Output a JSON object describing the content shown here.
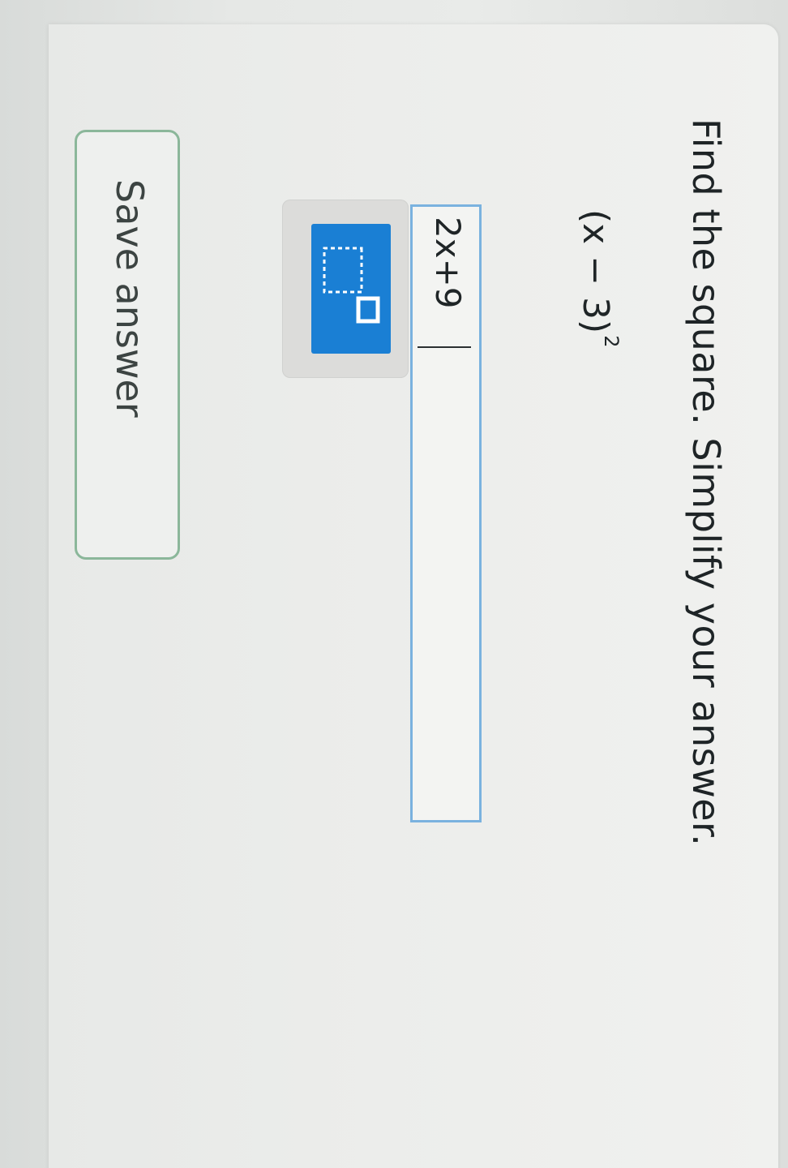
{
  "question": {
    "prompt": "Find the square. Simplify your answer.",
    "expression_base": "(x − 3)",
    "expression_exponent": "2"
  },
  "answer": {
    "value": "2x+9"
  },
  "toolbar": {
    "exponent_button_icon": "exponent-template-icon"
  },
  "actions": {
    "save_label": "Save answer"
  },
  "colors": {
    "accent_blue": "#1a7fd4",
    "field_border": "#7ab2df",
    "save_border": "#8bb79a"
  }
}
